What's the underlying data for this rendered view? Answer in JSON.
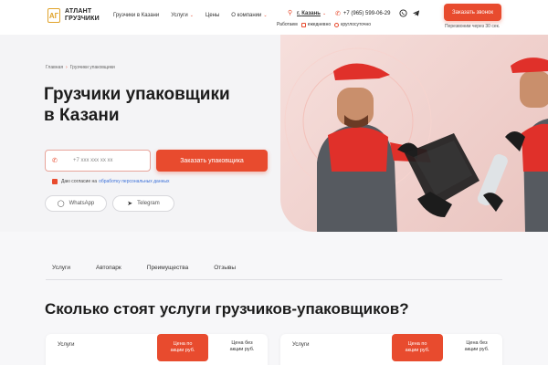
{
  "header": {
    "logo_mark": "АГ",
    "logo_line1": "АТЛАНТ",
    "logo_line2": "ГРУЗЧИКИ",
    "nav": [
      {
        "label": "Грузчики в Казани",
        "has_dropdown": false
      },
      {
        "label": "Услуги",
        "has_dropdown": true
      },
      {
        "label": "Цены",
        "has_dropdown": false
      },
      {
        "label": "О компании",
        "has_dropdown": true
      }
    ],
    "city_prefix": "г.",
    "city": "Казань",
    "phone": "+7 (965) 599-06-29",
    "work_label": "Работаем",
    "work_daily": "ежедневно",
    "work_24": "круглосуточно",
    "cta": "Заказать звонок",
    "callback_note": "Перезвоним через 30 сек."
  },
  "hero": {
    "breadcrumb_home": "Главная",
    "breadcrumb_current": "Грузчики упаковщики",
    "title_line1": "Грузчики упаковщики",
    "title_line2": "в Казани",
    "phone_placeholder": "+7 xxx xxx xx xx",
    "cta": "Заказать упаковщика",
    "consent_text": "Даю согласие на",
    "consent_link": "обработку персональных данных",
    "whatsapp": "WhatsApp",
    "telegram": "Telegram"
  },
  "tabs": [
    "Услуги",
    "Автопарк",
    "Преимущества",
    "Отзывы"
  ],
  "section_title": "Сколько стоят услуги грузчиков-упаковщиков?",
  "price_tables": [
    {
      "col_service": "Услуги",
      "col_discount_1": "Цена по",
      "col_discount_2": "акции руб.",
      "col_nodisc_1": "Цена без",
      "col_nodisc_2": "акции руб."
    },
    {
      "col_service": "Услуги",
      "col_discount_1": "Цена по",
      "col_discount_2": "акции руб.",
      "col_nodisc_1": "Цена без",
      "col_nodisc_2": "акции руб."
    }
  ],
  "colors": {
    "accent": "#e84b2e",
    "logo": "#e0a32a",
    "link": "#3a6fd8"
  }
}
